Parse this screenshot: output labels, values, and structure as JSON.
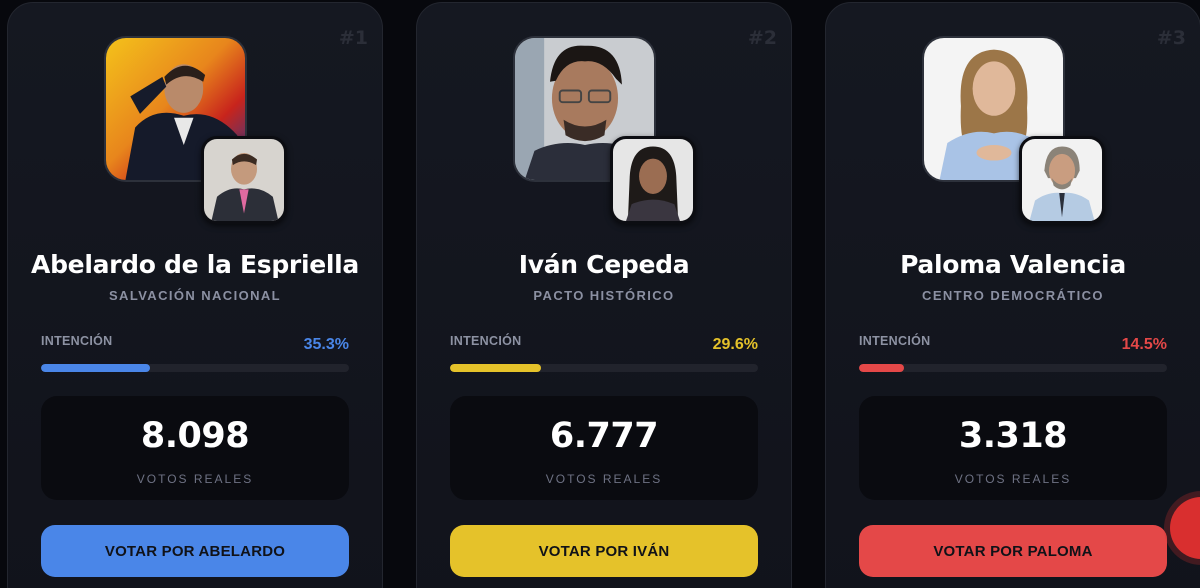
{
  "colors": {
    "blue": "#4a86e8",
    "yellow": "#e5c22a",
    "red": "#e44848"
  },
  "candidates": [
    {
      "rank": "#1",
      "name": "Abelardo de la Espriella",
      "party": "SALVACIÓN NACIONAL",
      "intention_label": "INTENCIÓN",
      "intention_pct": "35.3%",
      "intention_value": 35.3,
      "votes": "8.098",
      "votes_label": "VOTOS REALES",
      "button_label": "VOTAR POR ABELARDO",
      "accent": "#4a86e8",
      "pct_color": "#4a86e8"
    },
    {
      "rank": "#2",
      "name": "Iván Cepeda",
      "party": "PACTO HISTÓRICO",
      "intention_label": "INTENCIÓN",
      "intention_pct": "29.6%",
      "intention_value": 29.6,
      "votes": "6.777",
      "votes_label": "VOTOS REALES",
      "button_label": "VOTAR POR IVÁN",
      "accent": "#e5c22a",
      "pct_color": "#e5c22a"
    },
    {
      "rank": "#3",
      "name": "Paloma Valencia",
      "party": "CENTRO DEMOCRÁTICO",
      "intention_label": "INTENCIÓN",
      "intention_pct": "14.5%",
      "intention_value": 14.5,
      "votes": "3.318",
      "votes_label": "VOTOS REALES",
      "button_label": "VOTAR POR PALOMA",
      "accent": "#e44848",
      "pct_color": "#e44848"
    }
  ]
}
